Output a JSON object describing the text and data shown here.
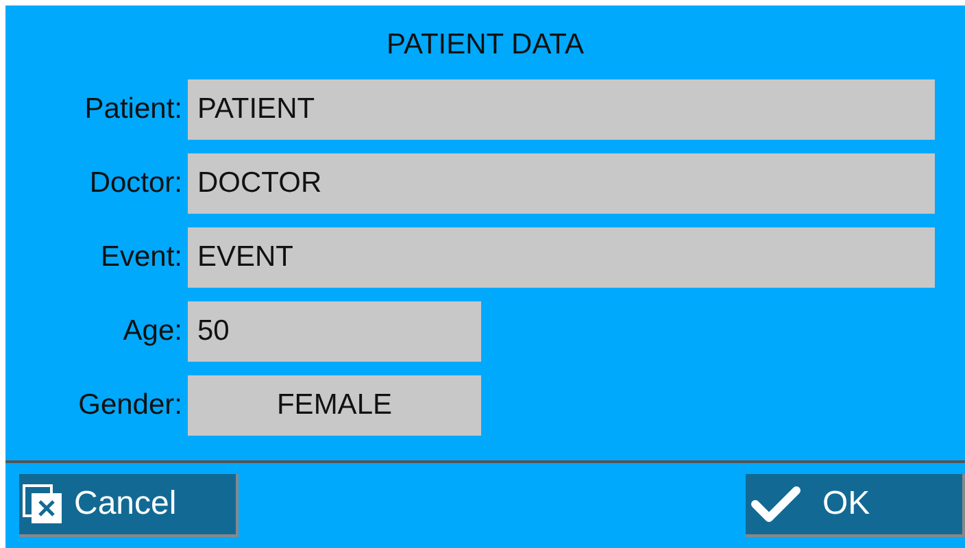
{
  "title": "PATIENT DATA",
  "fields": [
    {
      "label": "Patient:",
      "value": "PATIENT",
      "kind": "text"
    },
    {
      "label": "Doctor:",
      "value": "DOCTOR",
      "kind": "text"
    },
    {
      "label": "Event:",
      "value": "EVENT",
      "kind": "text"
    },
    {
      "label": "Age:",
      "value": "50",
      "kind": "number"
    },
    {
      "label": "Gender:",
      "value": "FEMALE",
      "kind": "choice"
    }
  ],
  "buttons": [
    {
      "label": "Cancel",
      "kind": "cancel"
    },
    {
      "label": "OK",
      "kind": "ok"
    }
  ]
}
